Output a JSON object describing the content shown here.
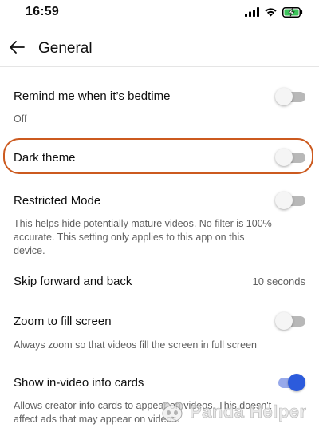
{
  "status_bar": {
    "time": "16:59",
    "icons": [
      "signal-icon",
      "wifi-icon",
      "battery-charging-icon"
    ]
  },
  "header": {
    "back_icon": "arrow-left-icon",
    "title": "General"
  },
  "settings": [
    {
      "label": "Remind me when it’s bedtime",
      "subtitle": "Off",
      "control": "toggle",
      "on": false
    },
    {
      "label": "Dark theme",
      "control": "toggle",
      "on": false,
      "highlighted": true
    },
    {
      "label": "Restricted Mode",
      "subtitle": "This helps hide potentially mature videos. No filter is 100% accurate. This setting only applies to this app on this device.",
      "control": "toggle",
      "on": false
    },
    {
      "label": "Skip forward and back",
      "value": "10 seconds"
    },
    {
      "label": "Zoom to fill screen",
      "subtitle": "Always zoom so that videos fill the screen in full screen",
      "control": "toggle",
      "on": false
    },
    {
      "label": "Show in-video info cards",
      "subtitle": "Allows creator info cards to appear on videos. This doesn't affect ads that may appear on videos.",
      "control": "toggle",
      "on": true
    }
  ],
  "colors": {
    "toggle_on": "#2c5bdc",
    "toggle_off": "#b8b8b8",
    "highlight_ring": "#cc5a1f"
  },
  "watermark": {
    "text": "Panda Helper"
  }
}
